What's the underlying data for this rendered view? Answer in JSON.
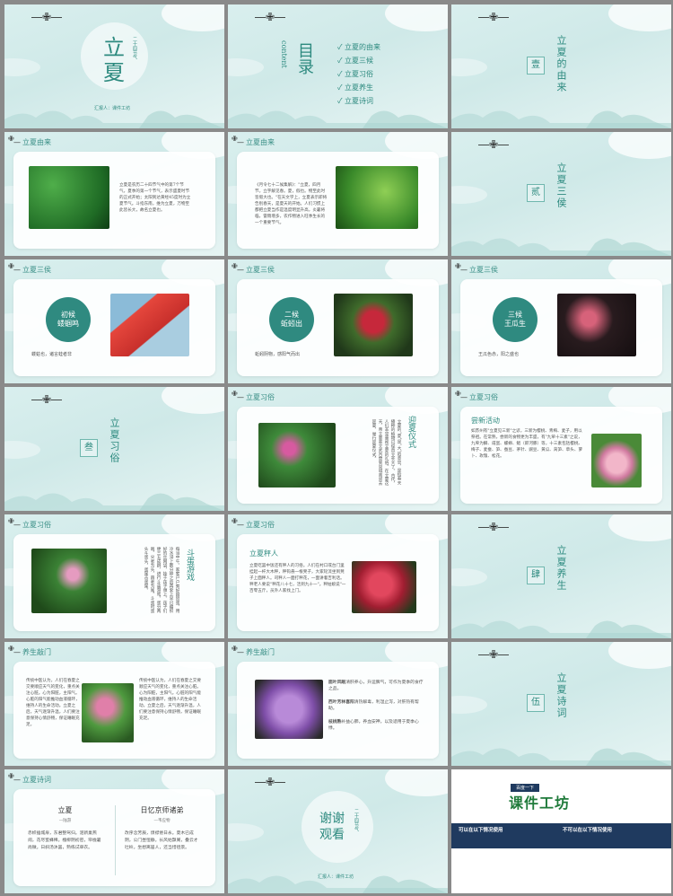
{
  "cover": {
    "title_1": "立",
    "title_2": "夏",
    "vertical_sub": "二十四节气",
    "author": "汇报人：课件工坊"
  },
  "toc": {
    "title": "目录",
    "subtitle": "content",
    "items": [
      "立夏的由来",
      "立夏三候",
      "立夏习俗",
      "立夏养生",
      "立夏诗词"
    ]
  },
  "sections": [
    {
      "num": "壹",
      "title": "立夏的由来"
    },
    {
      "num": "贰",
      "title": "立夏三侯"
    },
    {
      "num": "叁",
      "title": "立夏习俗"
    },
    {
      "num": "肆",
      "title": "立夏养生"
    },
    {
      "num": "伍",
      "title": "立夏诗词"
    }
  ],
  "headers": {
    "origin": "立夏由来",
    "three": "立夏三侯",
    "customs": "立夏习俗",
    "health": "养生敲门",
    "poems": "立夏诗词"
  },
  "origin_1_text": "立夏是农历二十四节气中的第7个节气，夏季的第一个节气，表示盛夏时节的正式开始；太阳到达黄经45度时为立夏节气。斗指东南，维为立夏，万物至此皆长大，故名立夏也。",
  "origin_2_text": "《月令七十二候集解》：\"立夏，四月节。立字解见春。夏，假也。物至此时皆假大也。\"在天文学上，立夏表示即将告别春天，是夏天的开始。人们习惯上都把立夏当作是温度明显升高，炎暑将临，雷雨增多，农作物进入旺季生长的一个重要节气。",
  "hou": [
    {
      "label_1": "初候",
      "label_2": "蝼蝈鸣",
      "caption": "蝼蛄也，诸言蛙者非"
    },
    {
      "label_1": "二候",
      "label_2": "蚯蚓出",
      "caption": "蚯蚓阴物，感阳气而出"
    },
    {
      "label_1": "三候",
      "label_2": "王瓜生",
      "caption": "王瓜色赤，阳之盛也"
    }
  ],
  "customs_1": {
    "title": "迎夏仪式",
    "text": "立夏的\"夏\"是\"大\"的意思，是指春天播种的植物已经直立长大了。古代，人们非常重视立夏的礼俗。在立夏这天，帝王要率文武百官到京城南郊去迎夏，举行迎夏仪式。"
  },
  "customs_2": {
    "title": "尝新活动",
    "text": "如苏州有\"立夏见三新\"之谚，三新为樱桃、青梅、麦子，用以祭祖。在常熟，尝新的食物更为丰盛，有\"九荤十三素\"之说，九荤为鲫、咸蛋、螺蛳、鲳（即河豚）等，十三素包括樱桃、梅子、麦蚕、笋、蚕豆、茅针、豌豆、黄瓜、莴笋、草头、萝卜、玫瑰、松花。"
  },
  "customs_3": {
    "title": "斗蛋游戏",
    "text": "每当中午，家家户户煮好囫囵蛋，用冷水浸上数分钟之后再套上早已编织好的丝网袋，挂于孩子颈上。孩子们便三五成群，进行斗蛋游戏。蛋分两端，尖者为头，圆者为尾。斗蛋时蛋头斗蛋头，蛋尾击蛋尾。"
  },
  "customs_4": {
    "title": "立夏秤人",
    "text": "立夏吃罢中饭还有秤人的习俗。人们在村口或台门里挂起一杆大木秤，秤钩悬一根凳子，大家轮流坐到凳子上面秤人。司秤人一面打秤花，一面讲着吉利话。秤老人要说\"秤花八十七，活到九十一\"。秤姑娘说\"一百零五斤，员外人家找上门。"
  },
  "health_1_text": "传统中医认为，人们在春夏之交要顺应天气的变化，重点关注心脏。心为阳脏，主阳气。心脏的阳气能推动血液循环，维持人的生命活动。立夏之后，天气逐渐升温，人们要注意保持心情舒畅，保证睡眠充足。",
  "health_2_items": [
    {
      "title": "面叶风眠",
      "text": "清肝养心，升运脾气，可作为夏季的食疗之品。"
    },
    {
      "title": "西叶芳林喜阳",
      "text": "清热解毒，利湿止泻，对肝热有帮助。"
    },
    {
      "title": "枝桃熟",
      "text": "补益心肺，养血安神，以及适用于夏季心悸。"
    }
  ],
  "poem_1": {
    "title": "立夏",
    "author": "—陆游",
    "text": "赤帜插城扉，东君整驾归。泥新巢燕闹，花尽蜜蜂稀。槐柳阴初密，帘栊暑尚微。日斜汤沐罢，熟练试单衣。"
  },
  "poem_2": {
    "title": "日忆京师诸弟",
    "author": "—韦应物",
    "text": "改序念芳辰，烦襟倦日永。夏木已成阴，公门昼恒静。长风始飘阁，叠云才吐岭。坐想离居人，还当惜徂景。"
  },
  "thanks": {
    "title_1": "谢谢",
    "title_2": "观看",
    "vertical_sub": "二十四节气",
    "author": "汇报人：课件工坊"
  },
  "ad": {
    "small": "百度一下",
    "brand": "课件工坊",
    "left_head": "可以在以下情况使用",
    "right_head": "不可以在以下情况使用"
  },
  "colors": {
    "accent": "#2d8a7f",
    "bg": "#d9efee",
    "gap": "#8a8a8a",
    "navy": "#1f3a5f"
  }
}
